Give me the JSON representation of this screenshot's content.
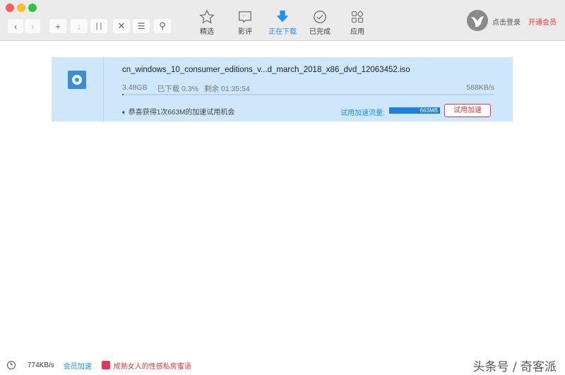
{
  "toolbar": {
    "nav": [
      {
        "label": "精选",
        "icon": "star-icon"
      },
      {
        "label": "影评",
        "icon": "comment-icon"
      },
      {
        "label": "正在下载",
        "icon": "download-icon"
      },
      {
        "label": "已完成",
        "icon": "check-circle-icon"
      },
      {
        "label": "应用",
        "icon": "apps-icon"
      }
    ],
    "login": "点击登录",
    "vip": "开通会员"
  },
  "download": {
    "filename": "cn_windows_10_consumer_editions_v...d_march_2018_x86_dvd_12063452.iso",
    "size": "3.48GB",
    "downloaded": "已下载 0.3%",
    "remaining": "剩余 01:35:54",
    "speed": "588KB/s",
    "progress": 0.003,
    "notice": "恭喜获得1次663M的加速试用机会",
    "trial_label": "试用加速流量:",
    "trial_amount": "663MB",
    "trial_button": "试用加速"
  },
  "status": {
    "speed": "774KB/s",
    "vip_accel": "会员加速",
    "ad": "成熟女人的性感私房蜜语",
    "watermark": "头条号 / 奇客派"
  },
  "colors": {
    "accent": "#1e90ff",
    "red": "#e23a3a",
    "row": "#cfe7fa"
  }
}
